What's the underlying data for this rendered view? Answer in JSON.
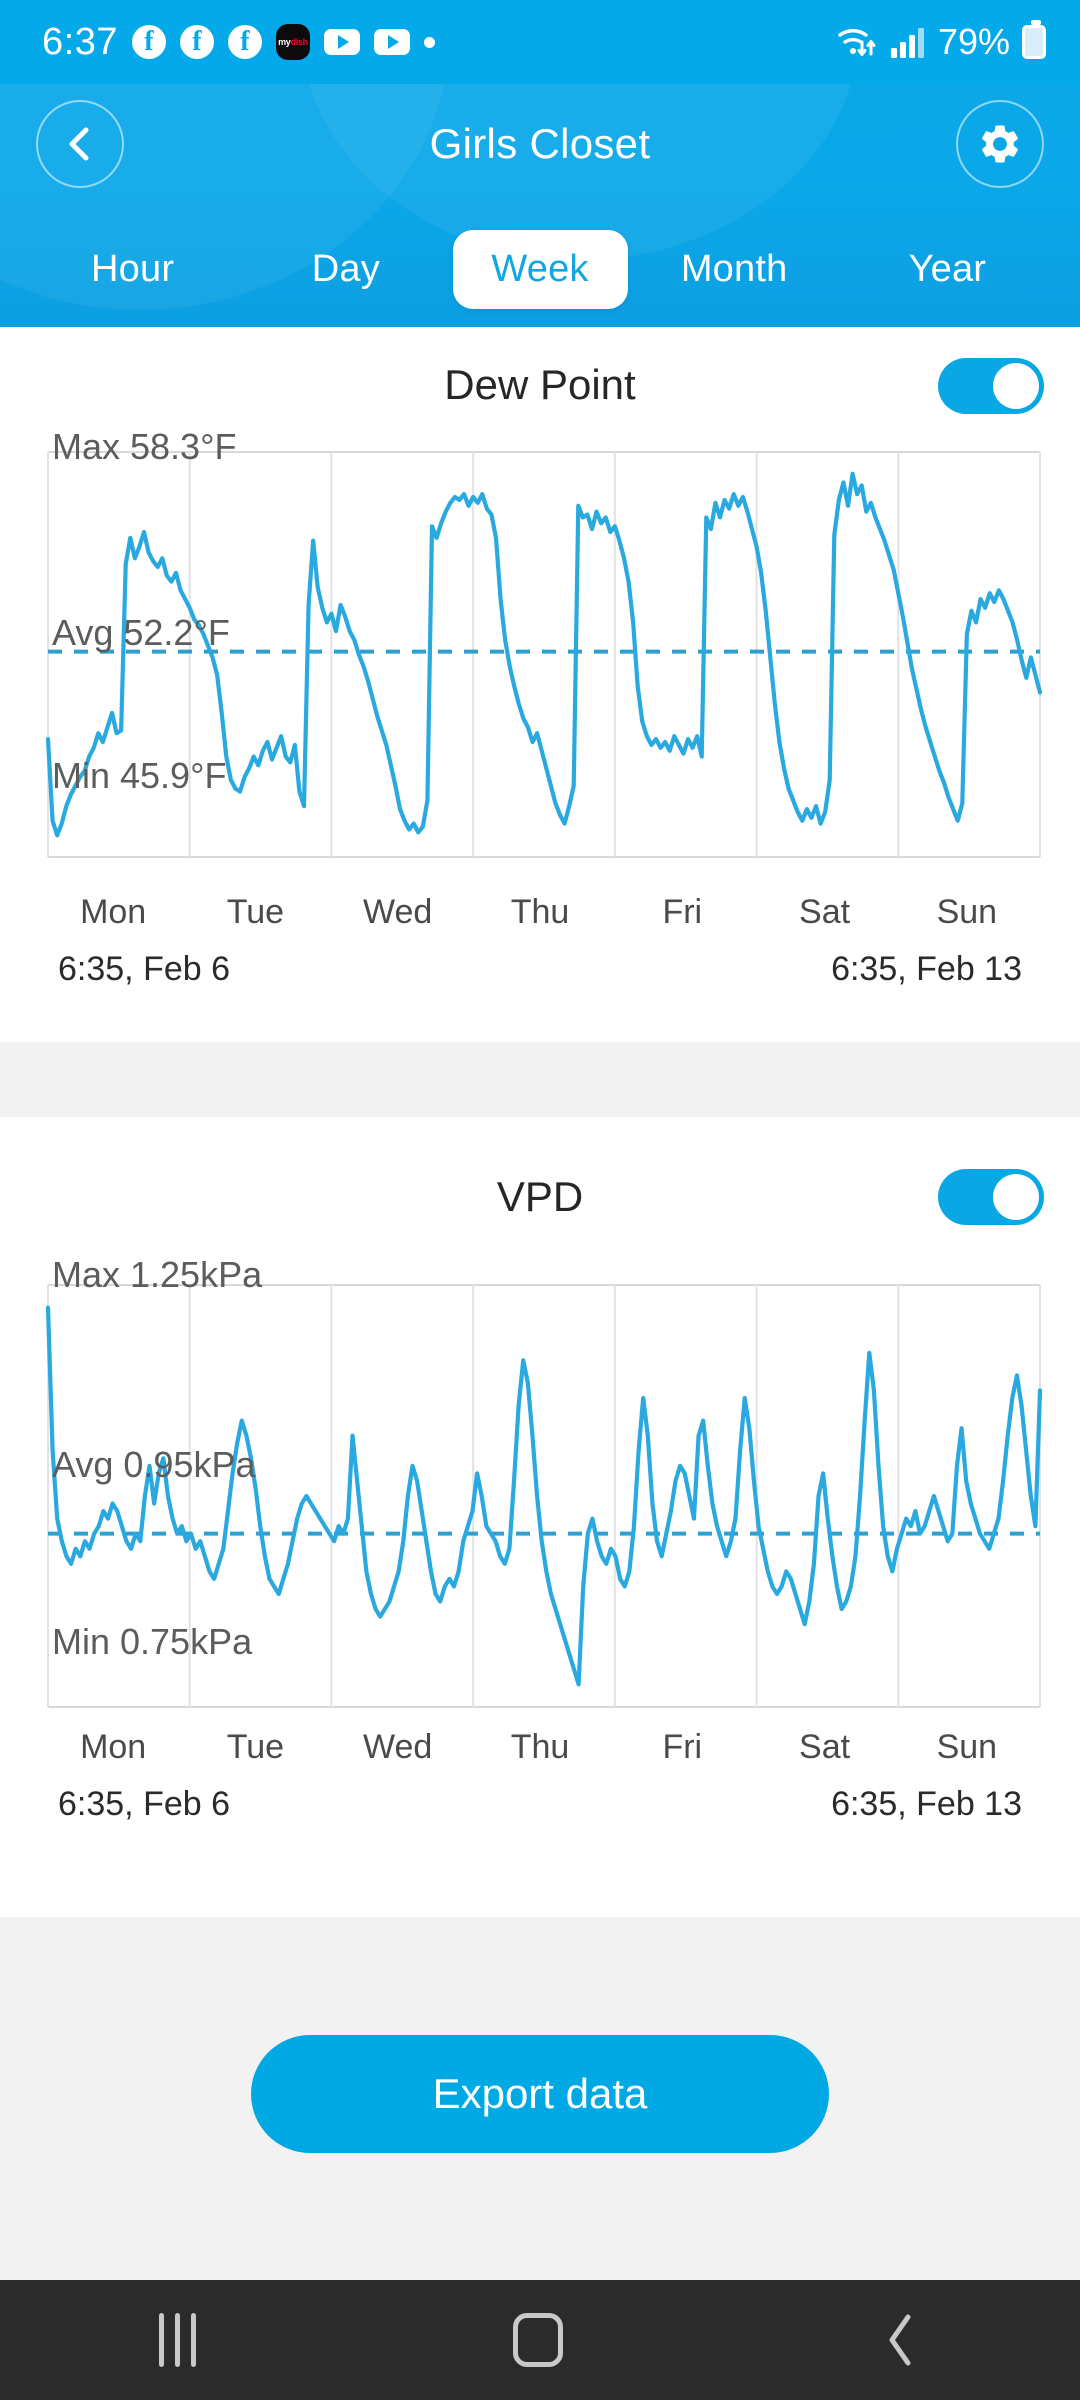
{
  "status_bar": {
    "time": "6:37",
    "battery_percent": "79%",
    "notification_icons": [
      "facebook-icon",
      "facebook-icon",
      "facebook-icon",
      "mydish-icon",
      "youtube-icon",
      "youtube-icon",
      "more-notifications-dot"
    ],
    "mydish_label_1": "my",
    "mydish_label_2": "dish",
    "right_icons": [
      "wifi-icon",
      "cellular-signal-icon",
      "battery-icon"
    ]
  },
  "header": {
    "title": "Girls Closet",
    "back_icon": "chevron-left-icon",
    "settings_icon": "gear-icon",
    "accent_color": "#0BA9E8"
  },
  "tabs": {
    "items": [
      {
        "label": "Hour",
        "active": false
      },
      {
        "label": "Day",
        "active": false
      },
      {
        "label": "Week",
        "active": true
      },
      {
        "label": "Month",
        "active": false
      },
      {
        "label": "Year",
        "active": false
      }
    ],
    "active_text_color": "#11A7E4"
  },
  "charts": [
    {
      "title": "Dew Point",
      "toggle_on": true,
      "max_label": "Max 58.3°F",
      "avg_label": "Avg 52.2°F",
      "min_label": "Min 45.9°F",
      "range_start": "6:35,  Feb 6",
      "range_end": "6:35,  Feb 13",
      "day_labels": [
        "Mon",
        "Tue",
        "Wed",
        "Thu",
        "Fri",
        "Sat",
        "Sun"
      ]
    },
    {
      "title": "VPD",
      "toggle_on": true,
      "max_label": "Max 1.25kPa",
      "avg_label": "Avg 0.95kPa",
      "min_label": "Min 0.75kPa",
      "range_start": "6:35,  Feb 6",
      "range_end": "6:35,  Feb 13",
      "day_labels": [
        "Mon",
        "Tue",
        "Wed",
        "Thu",
        "Fri",
        "Sat",
        "Sun"
      ]
    }
  ],
  "export": {
    "label": "Export data",
    "color": "#00A8E4"
  },
  "nav_bar": {
    "recents_icon": "recents-icon",
    "home_icon": "home-icon",
    "back_icon": "back-icon"
  },
  "chart_data": [
    {
      "type": "line",
      "title": "Dew Point",
      "xlabel": "",
      "ylabel": "°F",
      "unit": "°F",
      "ylim": [
        45.9,
        58.3
      ],
      "max": 58.3,
      "avg": 52.2,
      "min": 45.9,
      "grid": true,
      "legend": "none",
      "line_color": "#29A9E0",
      "avg_line_style": "dashed",
      "categories": [
        "Mon",
        "Tue",
        "Wed",
        "Thu",
        "Fri",
        "Sat",
        "Sun"
      ],
      "x_range": [
        "6:35, Feb 6",
        "6:35, Feb 13"
      ],
      "values": [
        49.2,
        46.4,
        45.9,
        46.3,
        46.9,
        47.3,
        47.6,
        47.9,
        48.1,
        48.6,
        48.9,
        49.4,
        49.1,
        49.6,
        50.1,
        49.4,
        49.5,
        55.2,
        56.1,
        55.4,
        55.8,
        56.3,
        55.6,
        55.3,
        55.1,
        55.4,
        54.8,
        54.6,
        54.9,
        54.3,
        54.0,
        53.7,
        53.3,
        53.1,
        52.8,
        52.4,
        52.0,
        51.4,
        50.1,
        48.6,
        47.8,
        47.5,
        47.4,
        47.9,
        48.2,
        48.6,
        48.3,
        48.8,
        49.1,
        48.5,
        48.9,
        49.3,
        48.6,
        48.4,
        49.0,
        47.4,
        46.9,
        53.8,
        56.0,
        54.4,
        53.7,
        53.2,
        53.5,
        52.9,
        53.8,
        53.4,
        52.9,
        52.6,
        52.1,
        51.7,
        51.2,
        50.6,
        50.0,
        49.5,
        49.0,
        48.3,
        47.6,
        46.8,
        46.4,
        46.1,
        46.3,
        46.0,
        46.2,
        47.1,
        56.5,
        56.1,
        56.6,
        57.0,
        57.3,
        57.5,
        57.4,
        57.6,
        57.2,
        57.5,
        57.3,
        57.6,
        57.1,
        56.9,
        56.1,
        54.0,
        52.6,
        51.7,
        51.0,
        50.4,
        49.9,
        49.6,
        49.1,
        49.4,
        48.8,
        48.2,
        47.6,
        47.0,
        46.6,
        46.3,
        46.9,
        47.6,
        57.2,
        56.8,
        56.9,
        56.4,
        57.0,
        56.6,
        56.8,
        56.3,
        56.5,
        56.0,
        55.4,
        54.6,
        53.2,
        51.0,
        49.8,
        49.3,
        49.0,
        49.2,
        48.9,
        49.1,
        48.8,
        49.3,
        49.0,
        48.7,
        49.2,
        48.9,
        49.3,
        48.6,
        56.8,
        56.4,
        57.3,
        56.8,
        57.4,
        57.1,
        57.6,
        57.2,
        57.5,
        57.0,
        56.4,
        55.8,
        54.9,
        53.6,
        52.0,
        50.4,
        49.1,
        48.2,
        47.5,
        47.1,
        46.7,
        46.4,
        46.8,
        46.5,
        46.9,
        46.3,
        46.7,
        47.8,
        56.2,
        57.4,
        58.0,
        57.2,
        58.3,
        57.6,
        57.9,
        57.0,
        57.3,
        56.8,
        56.4,
        56.0,
        55.5,
        55.0,
        54.2,
        53.4,
        52.5,
        51.6,
        50.9,
        50.2,
        49.6,
        49.1,
        48.6,
        48.1,
        47.7,
        47.2,
        46.8,
        46.4,
        47.0,
        52.8,
        53.6,
        53.2,
        54.0,
        53.7,
        54.2,
        53.9,
        54.3,
        54.0,
        53.6,
        53.2,
        52.6,
        51.9,
        51.3,
        52.0,
        51.4,
        50.8
      ]
    },
    {
      "type": "line",
      "title": "VPD",
      "xlabel": "",
      "ylabel": "kPa",
      "unit": "kPa",
      "ylim": [
        0.75,
        1.25
      ],
      "max": 1.25,
      "avg": 0.95,
      "min": 0.75,
      "grid": true,
      "legend": "none",
      "line_color": "#29A9E0",
      "avg_line_style": "dashed",
      "categories": [
        "Mon",
        "Tue",
        "Wed",
        "Thu",
        "Fri",
        "Sat",
        "Sun"
      ],
      "x_range": [
        "6:35, Feb 6",
        "6:35, Feb 13"
      ],
      "values": [
        1.25,
        1.06,
        0.97,
        0.94,
        0.92,
        0.91,
        0.93,
        0.92,
        0.94,
        0.93,
        0.95,
        0.96,
        0.98,
        0.97,
        0.99,
        0.98,
        0.96,
        0.94,
        0.93,
        0.95,
        0.94,
        1.0,
        1.04,
        0.99,
        1.03,
        1.05,
        1.0,
        0.97,
        0.95,
        0.96,
        0.94,
        0.95,
        0.93,
        0.94,
        0.92,
        0.9,
        0.89,
        0.91,
        0.93,
        0.98,
        1.03,
        1.07,
        1.1,
        1.08,
        1.05,
        1.01,
        0.96,
        0.92,
        0.89,
        0.88,
        0.87,
        0.89,
        0.91,
        0.94,
        0.97,
        0.99,
        1.0,
        0.99,
        0.98,
        0.97,
        0.96,
        0.95,
        0.94,
        0.96,
        0.95,
        0.97,
        1.08,
        1.02,
        0.96,
        0.9,
        0.87,
        0.85,
        0.84,
        0.85,
        0.86,
        0.88,
        0.9,
        0.94,
        1.0,
        1.04,
        1.02,
        0.98,
        0.94,
        0.9,
        0.87,
        0.86,
        0.88,
        0.89,
        0.88,
        0.9,
        0.94,
        0.96,
        0.98,
        1.03,
        1.0,
        0.96,
        0.95,
        0.94,
        0.92,
        0.91,
        0.93,
        1.02,
        1.12,
        1.18,
        1.15,
        1.08,
        1.0,
        0.94,
        0.9,
        0.87,
        0.85,
        0.83,
        0.81,
        0.79,
        0.77,
        0.75,
        0.88,
        0.95,
        0.97,
        0.94,
        0.92,
        0.91,
        0.93,
        0.92,
        0.89,
        0.88,
        0.9,
        0.96,
        1.06,
        1.13,
        1.08,
        0.99,
        0.94,
        0.92,
        0.95,
        0.98,
        1.02,
        1.04,
        1.03,
        1.0,
        0.97,
        1.08,
        1.1,
        1.04,
        0.99,
        0.96,
        0.94,
        0.92,
        0.94,
        0.97,
        1.06,
        1.13,
        1.09,
        1.02,
        0.96,
        0.93,
        0.9,
        0.88,
        0.87,
        0.88,
        0.9,
        0.89,
        0.87,
        0.85,
        0.83,
        0.86,
        0.91,
        1.0,
        1.03,
        0.97,
        0.92,
        0.88,
        0.85,
        0.86,
        0.88,
        0.92,
        1.0,
        1.1,
        1.19,
        1.14,
        1.04,
        0.96,
        0.92,
        0.9,
        0.93,
        0.95,
        0.97,
        0.96,
        0.98,
        0.95,
        0.96,
        0.98,
        1.0,
        0.98,
        0.96,
        0.94,
        0.95,
        1.04,
        1.09,
        1.02,
        0.99,
        0.97,
        0.95,
        0.94,
        0.93,
        0.95,
        0.97,
        1.02,
        1.08,
        1.13,
        1.16,
        1.12,
        1.06,
        1.0,
        0.96,
        1.14
      ]
    }
  ]
}
